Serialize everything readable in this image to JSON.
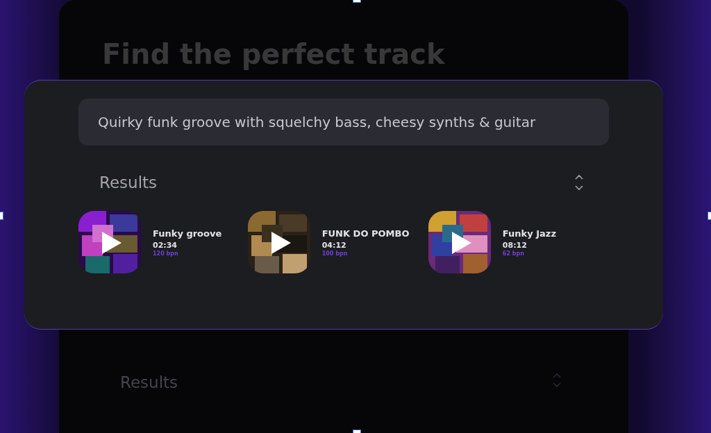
{
  "background_page": {
    "heading": "Find the perfect track",
    "results_title": "Results"
  },
  "search": {
    "value": "Quirky funk groove with squelchy bass, cheesy synths & guitar"
  },
  "results": {
    "title": "Results",
    "tracks": [
      {
        "title": "Funky groove",
        "duration": "02:34",
        "tempo": "120 bpn",
        "kind": "picture"
      },
      {
        "title": "FUNK DO POMBO",
        "duration": "04:12",
        "tempo": "100 bpn",
        "kind": "picture"
      },
      {
        "title": "Funky Jazz",
        "duration": "08:12",
        "tempo": "62 bpn",
        "kind": "picture"
      }
    ]
  }
}
